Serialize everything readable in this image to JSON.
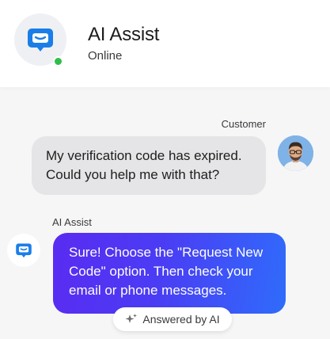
{
  "header": {
    "agent_name": "AI Assist",
    "status": "Online",
    "avatar_icon": "chat-bubble-icon",
    "status_color": "#2fbe4a",
    "brand_color": "#1a7ee8"
  },
  "messages": [
    {
      "sender": "Customer",
      "lines": [
        "My verification code has expired.",
        "Could you help me with that?"
      ],
      "avatar": "customer-avatar"
    },
    {
      "sender": "AI Assist",
      "lines": [
        "Sure! Choose the \"Request New",
        "Code\" option. Then check your",
        "email or phone messages."
      ],
      "avatar_icon": "chat-bubble-icon",
      "badge": "Answered by AI",
      "badge_icon": "sparkle-icon",
      "gradient": [
        "#5a2bf2",
        "#2f6cfb"
      ]
    }
  ]
}
